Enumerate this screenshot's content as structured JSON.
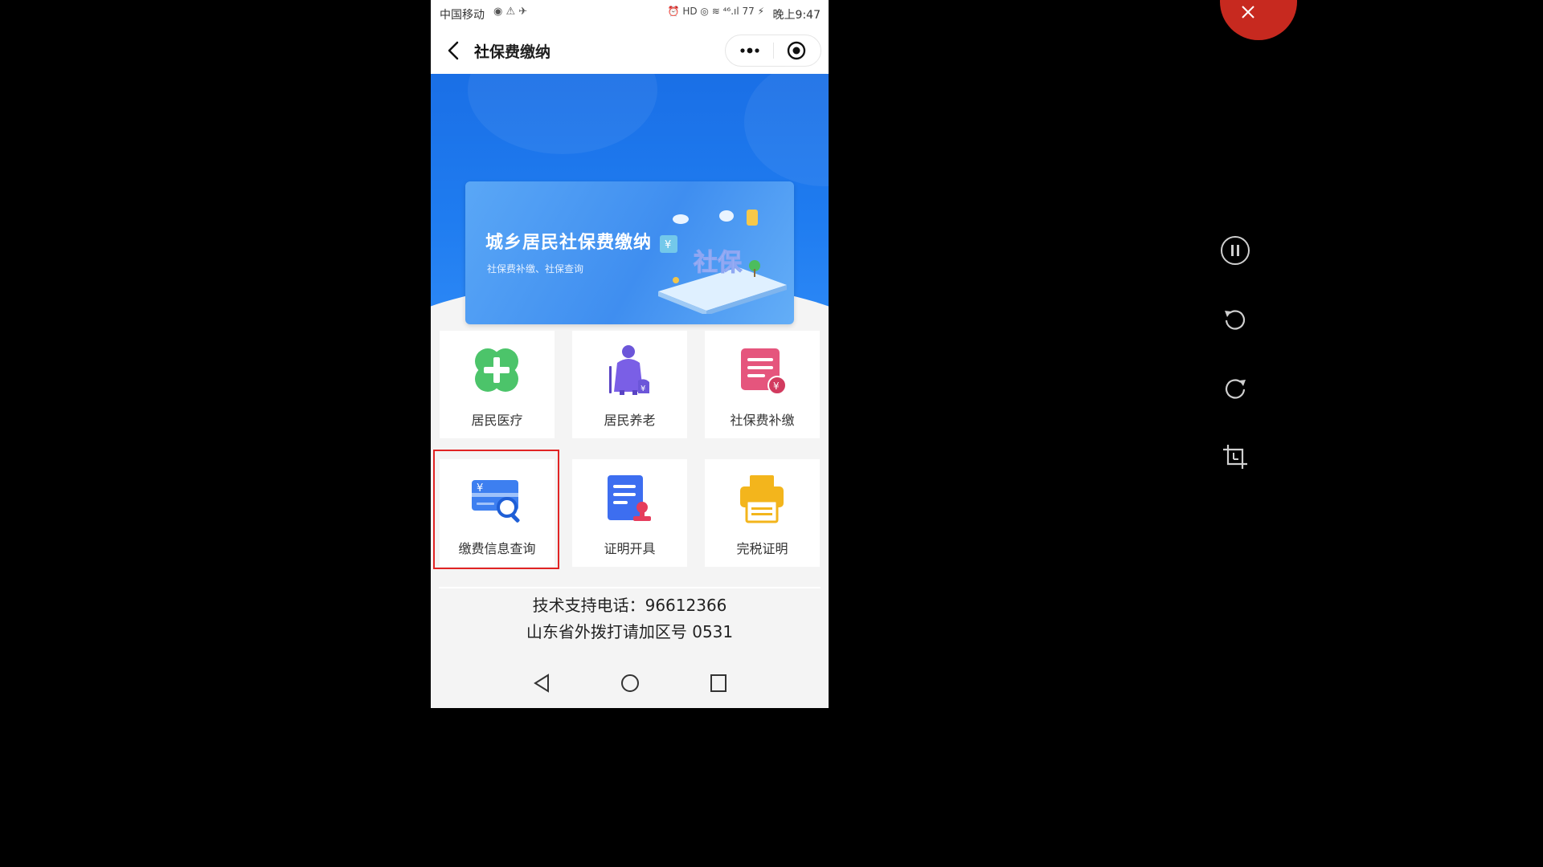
{
  "status_bar": {
    "carrier": "中国移动",
    "icons_left": "◉ ⚠ ✈",
    "icons_right": "⏰ HD ◎ ≋ ⁴⁶.ıl 77 ⚡",
    "time": "晚上9:47"
  },
  "title_bar": {
    "title": "社保费缴纳"
  },
  "banner": {
    "title": "城乡居民社保费缴纳",
    "subtitle": "社保费补缴、社保查询",
    "illustration_text": "社保"
  },
  "tiles": [
    {
      "label": "居民医疗",
      "icon": "medical-cross-icon",
      "color": "#4cc46a"
    },
    {
      "label": "居民养老",
      "icon": "elderly-person-icon",
      "color": "#7a5fe6"
    },
    {
      "label": "社保费补缴",
      "icon": "document-payment-icon",
      "color": "#e5557d"
    },
    {
      "label": "缴费信息查询",
      "icon": "card-search-icon",
      "color": "#3d7ff0"
    },
    {
      "label": "证明开具",
      "icon": "certificate-stamp-icon",
      "color": "#3d6ef0"
    },
    {
      "label": "完税证明",
      "icon": "printer-icon",
      "color": "#f3b51c"
    }
  ],
  "support": {
    "line1": "技术支持电话：96612366",
    "line2": "山东省外拨打请加区号 0531"
  },
  "colors": {
    "hero_blue": "#1a6fe6",
    "highlight_red": "#e12424",
    "close_red": "#c7291f"
  }
}
